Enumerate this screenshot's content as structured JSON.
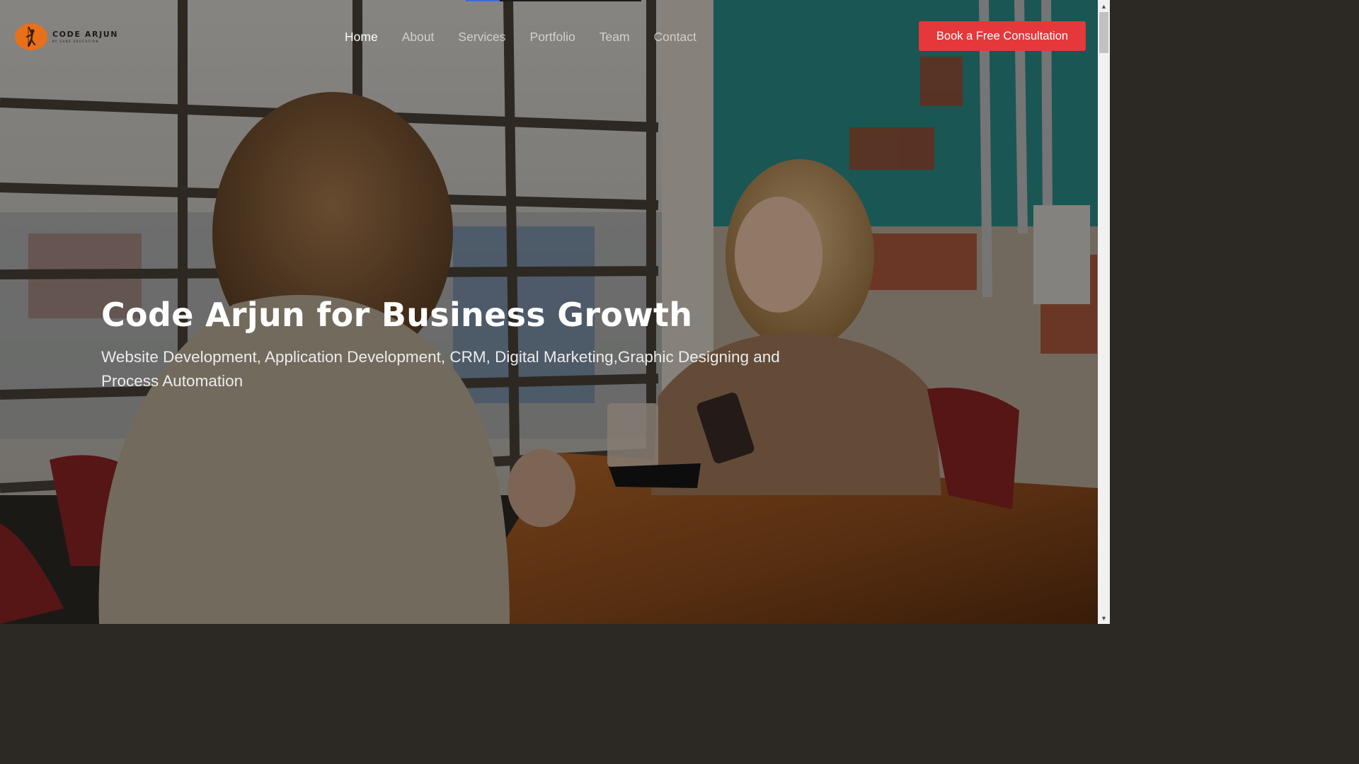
{
  "brand": {
    "name": "CODE ARJUN",
    "tagline": "BY SANS EDUCATION",
    "logo_icon": "archer-logo-icon",
    "logo_color": "#e8701a"
  },
  "nav": {
    "items": [
      {
        "label": "Home",
        "active": true
      },
      {
        "label": "About",
        "active": false
      },
      {
        "label": "Services",
        "active": false
      },
      {
        "label": "Portfolio",
        "active": false
      },
      {
        "label": "Team",
        "active": false
      },
      {
        "label": "Contact",
        "active": false
      }
    ]
  },
  "cta": {
    "label": "Book a Free Consultation",
    "color": "#e5383b"
  },
  "hero": {
    "title": "Code Arjun for Business Growth",
    "subtitle": "Website Development, Application Development, CRM, Digital Marketing,Graphic Designing and Process Automation"
  },
  "scrollbar": {
    "up_icon": "scroll-up-arrow-icon",
    "down_icon": "scroll-down-arrow-icon"
  }
}
